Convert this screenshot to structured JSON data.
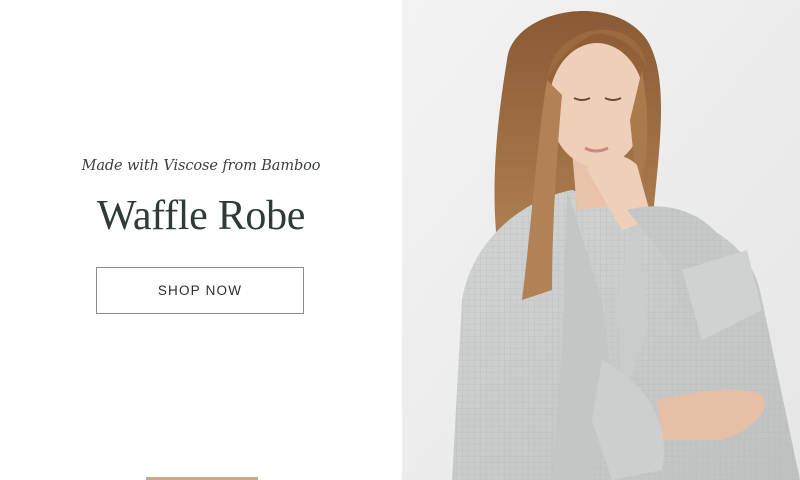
{
  "promo": {
    "tagline": "Made with Viscose from Bamboo",
    "title": "Waffle Robe",
    "cta_label": "SHOP NOW"
  },
  "image": {
    "subject": "model-wearing-waffle-robe-photo"
  },
  "colors": {
    "title_text": "#2f3b39",
    "button_border": "#8a8f8e",
    "photo_background": "#eeeeee",
    "robe": "#c9cbcb"
  }
}
